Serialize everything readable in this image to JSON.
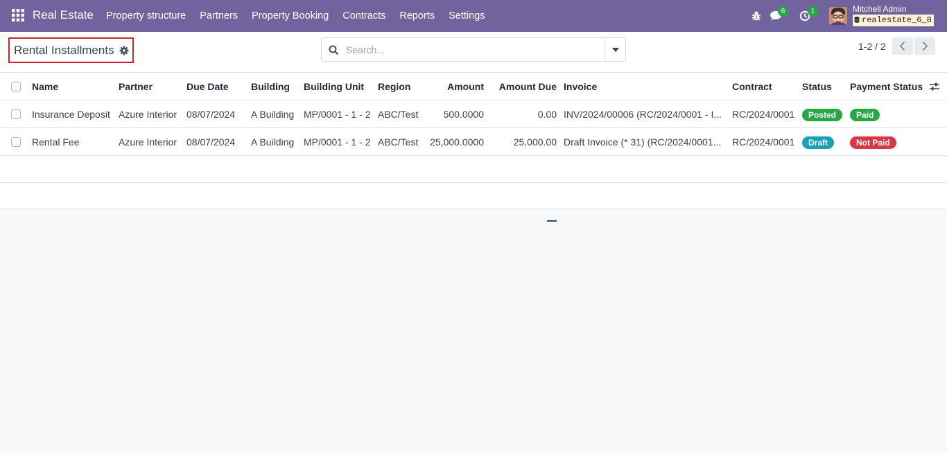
{
  "navbar": {
    "app_name": "Real Estate",
    "menu": [
      "Property structure",
      "Partners",
      "Property Booking",
      "Contracts",
      "Reports",
      "Settings"
    ],
    "messages_count": "6",
    "activities_count": "1",
    "user_name": "Mitchell Admin",
    "database": "realestate_6_8",
    "icons": [
      "apps-grid-icon",
      "bug-icon",
      "chat-icon",
      "clock-icon",
      "avatar"
    ]
  },
  "control_panel": {
    "title": "Rental Installments",
    "search_placeholder": "Search...",
    "pager": "1-2 / 2"
  },
  "table": {
    "columns": [
      "Name",
      "Partner",
      "Due Date",
      "Building",
      "Building Unit",
      "Region",
      "Amount",
      "Amount Due",
      "Invoice",
      "Contract",
      "Status",
      "Payment Status"
    ],
    "rows": [
      {
        "name": "Insurance Deposit",
        "partner": "Azure Interior",
        "due_date": "08/07/2024",
        "building": "A Building",
        "building_unit": "MP/0001 - 1 - 2",
        "region": "ABC/Test",
        "amount": "500.0000",
        "amount_due": "0.00",
        "invoice": "INV/2024/00006 (RC/2024/0001 - I...",
        "contract": "RC/2024/0001",
        "status": "Posted",
        "payment_status": "Paid"
      },
      {
        "name": "Rental Fee",
        "partner": "Azure Interior",
        "due_date": "08/07/2024",
        "building": "A Building",
        "building_unit": "MP/0001 - 1 - 2",
        "region": "ABC/Test",
        "amount": "25,000.0000",
        "amount_due": "25,000.00",
        "invoice": "Draft Invoice (* 31) (RC/2024/0001...",
        "contract": "RC/2024/0001",
        "status": "Draft",
        "payment_status": "Not Paid"
      }
    ]
  },
  "colors": {
    "navbar": "#71639e",
    "posted": "#28a745",
    "paid": "#28a745",
    "draft": "#17a2b8",
    "not_paid": "#dc3545",
    "highlight_border": "#d2232a"
  }
}
